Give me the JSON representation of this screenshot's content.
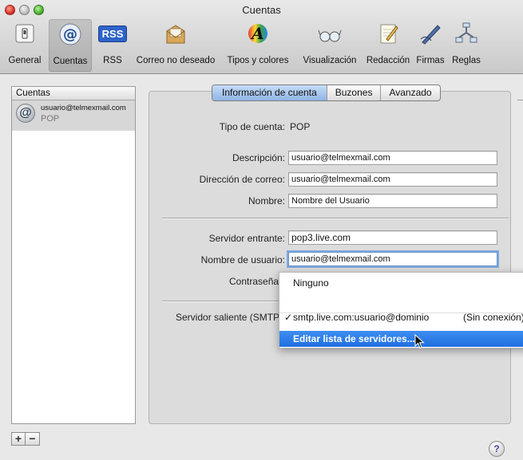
{
  "window": {
    "title": "Cuentas"
  },
  "toolbar": {
    "items": [
      {
        "label": "General",
        "icon": "general-switch-icon",
        "selected": false
      },
      {
        "label": "Cuentas",
        "icon": "at-sign-icon",
        "selected": true
      },
      {
        "label": "RSS",
        "icon": "rss-icon",
        "selected": false,
        "badge": "RSS"
      },
      {
        "label": "Correo no deseado",
        "icon": "junk-mail-icon",
        "selected": false
      },
      {
        "label": "Tipos y colores",
        "icon": "fonts-colors-icon",
        "selected": false,
        "glyph": "A"
      },
      {
        "label": "Visualización",
        "icon": "glasses-icon",
        "selected": false
      },
      {
        "label": "Redacción",
        "icon": "notepad-icon",
        "selected": false
      },
      {
        "label": "Firmas",
        "icon": "pen-icon",
        "selected": false
      },
      {
        "label": "Reglas",
        "icon": "rules-icon",
        "selected": false
      }
    ]
  },
  "sidebar": {
    "header": "Cuentas",
    "accounts": [
      {
        "name": "usuario@telmexmail.com",
        "type": "POP",
        "avatar_glyph": "@"
      }
    ],
    "add_label": "+",
    "remove_label": "−"
  },
  "tabs": [
    {
      "label": "Información de cuenta",
      "active": true
    },
    {
      "label": "Buzones",
      "active": false
    },
    {
      "label": "Avanzado",
      "active": false
    }
  ],
  "form": {
    "account_type_label": "Tipo de cuenta:",
    "account_type_value": "POP",
    "description_label": "Descripción:",
    "description_value": "usuario@telmexmail.com",
    "email_label": "Dirección de correo:",
    "email_value": "usuario@telmexmail.com",
    "name_label": "Nombre:",
    "name_value": "Nombre del Usuario",
    "incoming_label": "Servidor entrante:",
    "incoming_value": "pop3.live.com",
    "username_label": "Nombre de usuario:",
    "username_value": "usuario@telmexmail.com",
    "password_label": "Contraseña",
    "smtp_label": "Servidor saliente (SMTP)"
  },
  "smtp_menu": {
    "items": [
      {
        "label": "Ninguno",
        "checked": false
      },
      {
        "label": "smtp.live.com:usuario@dominio",
        "status": "(Sin conexión)",
        "checked": true,
        "check": "✓"
      },
      {
        "label": "Editar lista de servidores...",
        "highlighted": true
      }
    ]
  },
  "help_label": "?"
}
